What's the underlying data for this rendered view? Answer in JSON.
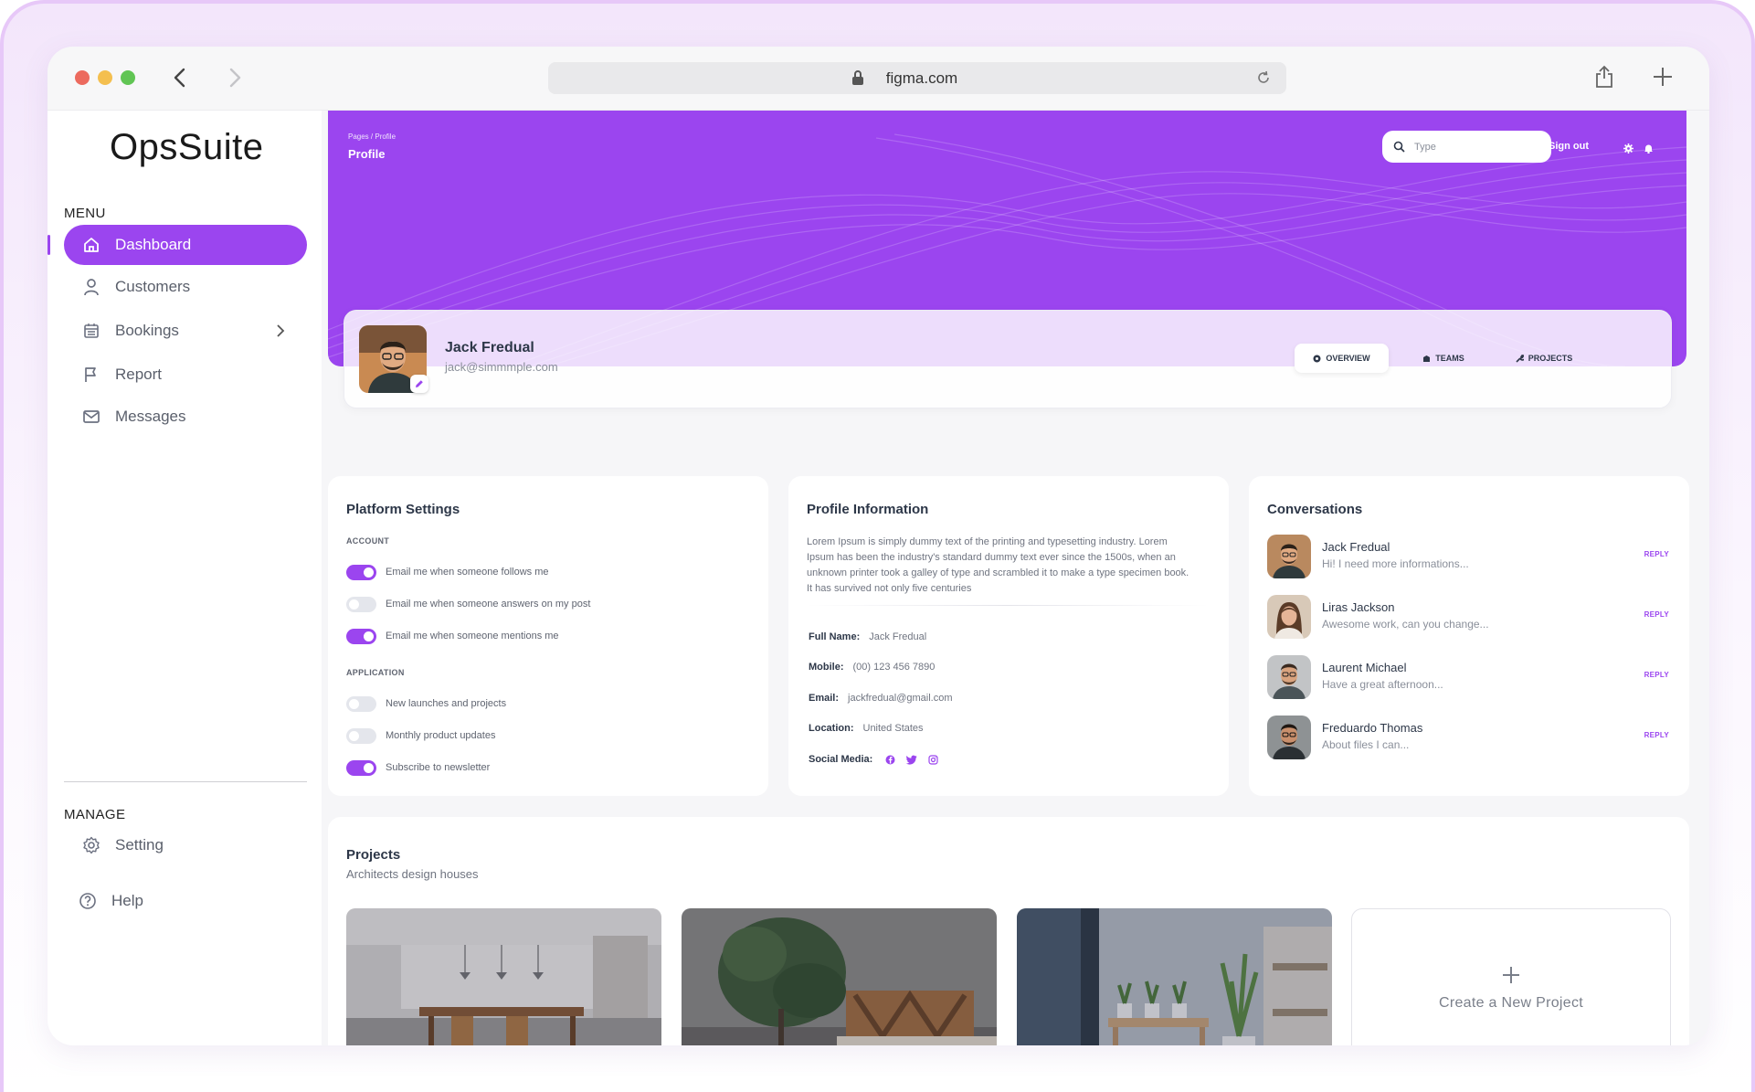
{
  "browser": {
    "url": "figma.com"
  },
  "sidebar": {
    "brand": "OpsSuite",
    "menu_title": "MENU",
    "items": [
      {
        "label": "Dashboard",
        "icon": "home-icon",
        "active": true
      },
      {
        "label": "Customers",
        "icon": "user-icon"
      },
      {
        "label": "Bookings",
        "icon": "calendar-icon"
      },
      {
        "label": "Report",
        "icon": "flag-icon"
      },
      {
        "label": "Messages",
        "icon": "mail-icon"
      }
    ],
    "manage_title": "MANAGE",
    "manage_items": [
      {
        "label": "Setting",
        "icon": "gear-icon"
      },
      {
        "label": "Help",
        "icon": "help-icon"
      }
    ]
  },
  "header": {
    "breadcrumb": "Pages  /  Profile",
    "title": "Profile",
    "search_placeholder": "Type",
    "sign_out": "Sign out"
  },
  "profile": {
    "name": "Jack Fredual",
    "email": "jack@simmmple.com",
    "tabs": [
      "OVERVIEW",
      "TEAMS",
      "PROJECTS"
    ]
  },
  "platform_settings": {
    "title": "Platform Settings",
    "account_title": "ACCOUNT",
    "account": [
      {
        "label": "Email me when someone follows me",
        "on": true
      },
      {
        "label": "Email me when someone answers on my post",
        "on": false
      },
      {
        "label": "Email me when someone mentions me",
        "on": true
      }
    ],
    "application_title": "APPLICATION",
    "application": [
      {
        "label": "New launches and projects",
        "on": false
      },
      {
        "label": "Monthly product updates",
        "on": false
      },
      {
        "label": "Subscribe to newsletter",
        "on": true
      }
    ]
  },
  "profile_info": {
    "title": "Profile Information",
    "about": "Lorem Ipsum is simply dummy text of the printing and typesetting industry. Lorem Ipsum has been the industry's standard dummy text ever since the 1500s, when an unknown printer took a galley of type and scrambled it to make a type specimen book. It has survived not only five centuries",
    "fields": [
      {
        "key": "Full Name:",
        "value": "Jack Fredual"
      },
      {
        "key": "Mobile:",
        "value": "(00) 123 456 7890"
      },
      {
        "key": "Email:",
        "value": "jackfredual@gmail.com"
      },
      {
        "key": "Location:",
        "value": "United States"
      }
    ],
    "social_label": "Social Media:",
    "social_icons": [
      "facebook-icon",
      "twitter-icon",
      "instagram-icon"
    ]
  },
  "conversations": {
    "title": "Conversations",
    "reply_label": "REPLY",
    "items": [
      {
        "name": "Jack Fredual",
        "message": "Hi! I need more informations..."
      },
      {
        "name": "Liras Jackson",
        "message": "Awesome work, can you change..."
      },
      {
        "name": "Laurent Michael",
        "message": "Have a great afternoon..."
      },
      {
        "name": "Freduardo Thomas",
        "message": "About files I can..."
      }
    ]
  },
  "projects": {
    "title": "Projects",
    "subtitle": "Architects design houses",
    "new_project": "Create a New Project"
  },
  "colors": {
    "accent": "#9b45ef",
    "background": "#f6f6f8"
  }
}
